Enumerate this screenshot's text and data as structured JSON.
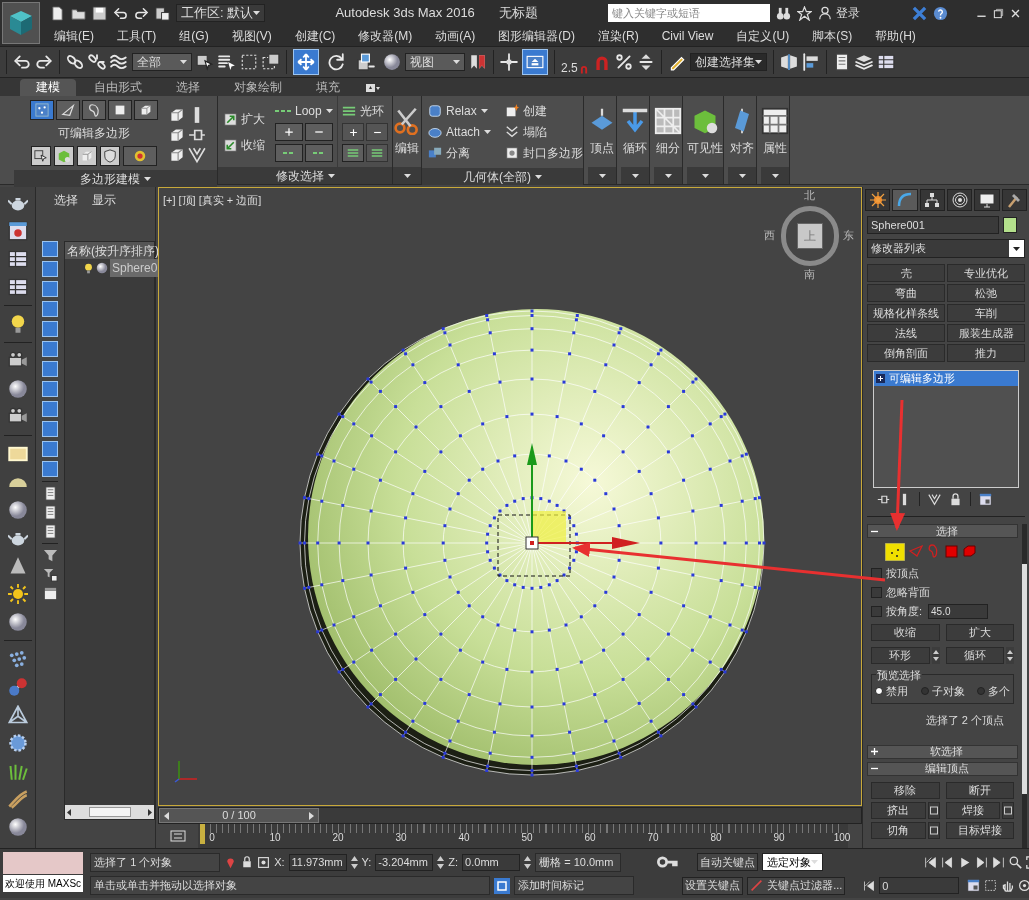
{
  "title_bar": {
    "workspace": "工作区: 默认",
    "app_title": "Autodesk 3ds Max 2016",
    "document_title": "无标题",
    "search_placeholder": "键入关键字或短语",
    "login": "登录"
  },
  "menu": [
    "编辑(E)",
    "工具(T)",
    "组(G)",
    "视图(V)",
    "创建(C)",
    "修改器(M)",
    "动画(A)",
    "图形编辑器(D)",
    "渲染(R)",
    "Civil View",
    "自定义(U)",
    "脚本(S)",
    "帮助(H)"
  ],
  "toolbar": {
    "selection_filter": "全部",
    "reference_coordinates": "视图",
    "snap_label": "2.5",
    "named_selection": "创建选择集",
    "transform_tools": [
      {
        "kind": "move",
        "selected": true
      },
      {
        "kind": "rotate",
        "selected": false
      },
      {
        "kind": "scale",
        "selected": false
      }
    ]
  },
  "ribbon": {
    "tabs": [
      {
        "label": "建模",
        "selected": true
      },
      {
        "label": "自由形式",
        "selected": false
      },
      {
        "label": "选择",
        "selected": false
      },
      {
        "label": "对象绘制",
        "selected": false
      },
      {
        "label": "填充",
        "selected": false
      }
    ],
    "polygon_modeling": {
      "title": "多边形建模",
      "label": "可编辑多边形",
      "levels": [
        {
          "kind": "vertex",
          "selected": true
        },
        {
          "kind": "edge",
          "selected": false
        },
        {
          "kind": "border",
          "selected": false
        },
        {
          "kind": "polygon",
          "selected": false
        },
        {
          "kind": "element",
          "selected": false
        }
      ]
    },
    "modify_selection": {
      "title": "修改选择",
      "grow": "扩大",
      "shrink": "收缩",
      "loop": "Loop",
      "ring": "光环"
    },
    "edit": {
      "label": "编辑"
    },
    "geometry": {
      "title": "几何体(全部)",
      "items": [
        "Relax",
        "Attach",
        "分离",
        "创建",
        "塌陷",
        "封口多边形"
      ]
    },
    "large_buttons": [
      {
        "kind": "vertex",
        "label": "顶点"
      },
      {
        "kind": "loop",
        "label": "循环"
      },
      {
        "kind": "subdivide",
        "label": "细分"
      },
      {
        "kind": "visibility",
        "label": "可见性"
      },
      {
        "kind": "align",
        "label": "对齐"
      },
      {
        "kind": "properties",
        "label": "属性"
      }
    ]
  },
  "scene_explorer": {
    "tabs": [
      "选择",
      "显示"
    ],
    "column": "名称(按升序排序)",
    "items": [
      {
        "name": "Sphere0",
        "selected": true
      }
    ]
  },
  "viewport": {
    "labels": [
      "[+]",
      "[顶]",
      "[真实 + 边面]"
    ],
    "viewcube": {
      "face": "上",
      "top": "北",
      "bottom": "南",
      "left": "西",
      "right": "东"
    }
  },
  "time_slider": {
    "label": "0 / 100",
    "level": 0
  },
  "track_ticks": [
    "0",
    "10",
    "20",
    "30",
    "40",
    "50",
    "60",
    "70",
    "80",
    "90",
    "100"
  ],
  "command_panel": {
    "tabs": [
      {
        "kind": "create",
        "selected": false
      },
      {
        "kind": "modify",
        "selected": true
      },
      {
        "kind": "hierarchy",
        "selected": false
      },
      {
        "kind": "motion",
        "selected": false
      },
      {
        "kind": "display",
        "selected": false
      },
      {
        "kind": "utilities",
        "selected": false
      }
    ],
    "object_name": "Sphere001",
    "modifier_list": "修改器列表",
    "modifier_buttons": [
      "壳",
      "专业优化",
      "弯曲",
      "松弛",
      "规格化样条线",
      "车削",
      "法线",
      "服装生成器",
      "倒角剖面",
      "推力"
    ],
    "stack": [
      {
        "label": "可编辑多边形",
        "selected": true
      }
    ],
    "rollouts": [
      {
        "kind": "selection",
        "title": "选择",
        "expanded": true,
        "levels": [
          {
            "kind": "vertex",
            "selected": true
          },
          {
            "kind": "edge",
            "selected": false
          },
          {
            "kind": "border",
            "selected": false
          },
          {
            "kind": "polygon",
            "selected": false
          },
          {
            "kind": "element",
            "selected": false
          }
        ],
        "options": [
          {
            "label": "按顶点",
            "checked": false
          },
          {
            "label": "忽略背面",
            "checked": false
          },
          {
            "label": "按角度:",
            "checked": false,
            "value": "45.0"
          }
        ],
        "buttons": [
          "收缩",
          "扩大"
        ],
        "spinner_buttons": [
          "环形",
          "循环"
        ],
        "preview": {
          "title": "预览选择",
          "options": [
            {
              "label": "禁用",
              "selected": true
            },
            {
              "label": "子对象",
              "selected": false
            },
            {
              "label": "多个",
              "selected": false
            }
          ]
        },
        "status": "选择了 2 个顶点"
      },
      {
        "kind": "soft",
        "title": "软选择",
        "expanded": false
      },
      {
        "kind": "edit_vertices",
        "title": "编辑顶点",
        "expanded": true,
        "buttons": [
          {
            "label": "移除",
            "settings": false
          },
          {
            "label": "断开",
            "settings": false
          },
          {
            "label": "挤出",
            "settings": true
          },
          {
            "label": "焊接",
            "settings": true
          },
          {
            "label": "切角",
            "settings": true
          },
          {
            "label": "目标焊接",
            "settings": false
          }
        ]
      }
    ]
  },
  "status_bar": {
    "maxscript": "欢迎使用 MAXSc",
    "selection": "选择了 1 个对象",
    "prompt": "单击或单击并拖动以选择对象",
    "coordinates": [
      {
        "label": "X:",
        "value": "11.973mm"
      },
      {
        "label": "Y:",
        "value": "-3.204mm"
      },
      {
        "label": "Z:",
        "value": "0.0mm"
      }
    ],
    "grid": "栅格 = 10.0mm",
    "add_time_tag": "添加时间标记",
    "auto_key": "自动关键点",
    "set_key": "设置关键点",
    "key_mode": "选定对象",
    "key_filters": "关键点过滤器...",
    "frame": "0"
  }
}
